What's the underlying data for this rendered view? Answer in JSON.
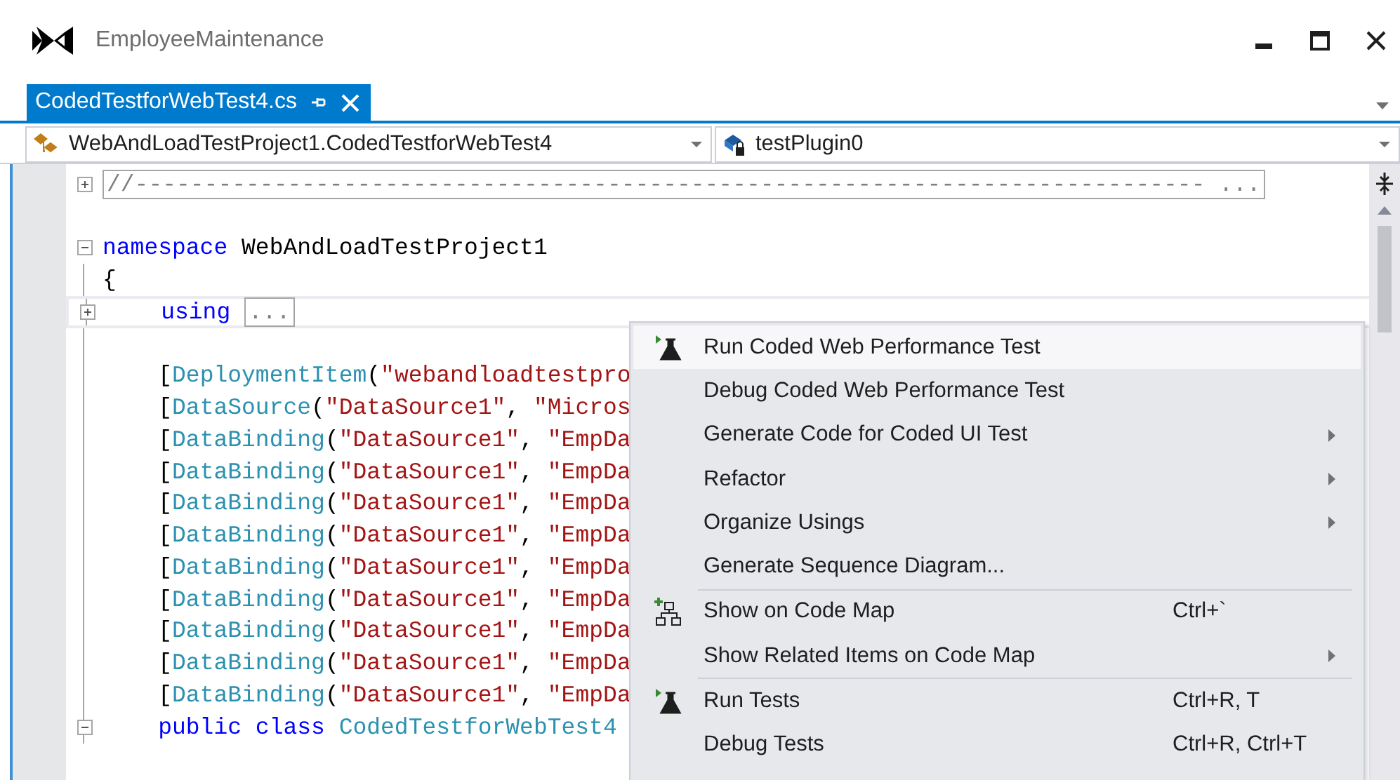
{
  "window": {
    "title": "EmployeeMaintenance"
  },
  "tabs": [
    {
      "label": "CodedTestforWebTest4.cs",
      "selected": true
    }
  ],
  "navigation": {
    "type_dropdown": "WebAndLoadTestProject1.CodedTestforWebTest4",
    "member_dropdown": "testPlugin0"
  },
  "code_lines": [
    {
      "kind": "collapsed-region",
      "current": false,
      "segments": [
        {
          "text": "//----------------------------------------------------------------------------- ...",
          "kind": "collapsed"
        }
      ]
    },
    {
      "kind": "blank",
      "current": false
    },
    {
      "kind": "region-start",
      "current": false,
      "segments": [
        {
          "text": "namespace",
          "kind": "keyword"
        },
        {
          "text": " WebAndLoadTestProject1",
          "kind": "plain"
        }
      ]
    },
    {
      "kind": "code",
      "current": false,
      "segments": [
        {
          "text": "{",
          "kind": "plain"
        }
      ]
    },
    {
      "kind": "collapsed-region",
      "current": true,
      "segments": [
        {
          "text": "    using ",
          "kind": "keyword"
        },
        {
          "text": "...",
          "kind": "collapsed"
        }
      ]
    },
    {
      "kind": "blank",
      "current": false
    },
    {
      "kind": "code",
      "current": false,
      "segments": [
        {
          "text": "    [",
          "kind": "plain"
        },
        {
          "text": "DeploymentItem",
          "kind": "type"
        },
        {
          "text": "(",
          "kind": "plain"
        },
        {
          "text": "\"webandloadtestpro",
          "kind": "string"
        }
      ]
    },
    {
      "kind": "code",
      "current": false,
      "segments": [
        {
          "text": "    [",
          "kind": "plain"
        },
        {
          "text": "DataSource",
          "kind": "type"
        },
        {
          "text": "(",
          "kind": "plain"
        },
        {
          "text": "\"DataSource1\"",
          "kind": "string"
        },
        {
          "text": ", ",
          "kind": "plain"
        },
        {
          "text": "\"Micros",
          "kind": "string"
        }
      ]
    },
    {
      "kind": "code",
      "current": false,
      "segments": [
        {
          "text": "    [",
          "kind": "plain"
        },
        {
          "text": "DataBinding",
          "kind": "type"
        },
        {
          "text": "(",
          "kind": "plain"
        },
        {
          "text": "\"DataSource1\"",
          "kind": "string"
        },
        {
          "text": ", ",
          "kind": "plain"
        },
        {
          "text": "\"EmpDa",
          "kind": "string"
        }
      ]
    },
    {
      "kind": "code",
      "current": false,
      "segments": [
        {
          "text": "    [",
          "kind": "plain"
        },
        {
          "text": "DataBinding",
          "kind": "type"
        },
        {
          "text": "(",
          "kind": "plain"
        },
        {
          "text": "\"DataSource1\"",
          "kind": "string"
        },
        {
          "text": ", ",
          "kind": "plain"
        },
        {
          "text": "\"EmpDa",
          "kind": "string"
        }
      ]
    },
    {
      "kind": "code",
      "current": false,
      "segments": [
        {
          "text": "    [",
          "kind": "plain"
        },
        {
          "text": "DataBinding",
          "kind": "type"
        },
        {
          "text": "(",
          "kind": "plain"
        },
        {
          "text": "\"DataSource1\"",
          "kind": "string"
        },
        {
          "text": ", ",
          "kind": "plain"
        },
        {
          "text": "\"EmpDa",
          "kind": "string"
        }
      ]
    },
    {
      "kind": "code",
      "current": false,
      "segments": [
        {
          "text": "    [",
          "kind": "plain"
        },
        {
          "text": "DataBinding",
          "kind": "type"
        },
        {
          "text": "(",
          "kind": "plain"
        },
        {
          "text": "\"DataSource1\"",
          "kind": "string"
        },
        {
          "text": ", ",
          "kind": "plain"
        },
        {
          "text": "\"EmpDa",
          "kind": "string"
        }
      ]
    },
    {
      "kind": "code",
      "current": false,
      "segments": [
        {
          "text": "    [",
          "kind": "plain"
        },
        {
          "text": "DataBinding",
          "kind": "type"
        },
        {
          "text": "(",
          "kind": "plain"
        },
        {
          "text": "\"DataSource1\"",
          "kind": "string"
        },
        {
          "text": ", ",
          "kind": "plain"
        },
        {
          "text": "\"EmpDa",
          "kind": "string"
        }
      ]
    },
    {
      "kind": "code",
      "current": false,
      "segments": [
        {
          "text": "    [",
          "kind": "plain"
        },
        {
          "text": "DataBinding",
          "kind": "type"
        },
        {
          "text": "(",
          "kind": "plain"
        },
        {
          "text": "\"DataSource1\"",
          "kind": "string"
        },
        {
          "text": ", ",
          "kind": "plain"
        },
        {
          "text": "\"EmpDa",
          "kind": "string"
        }
      ]
    },
    {
      "kind": "code",
      "current": false,
      "segments": [
        {
          "text": "    [",
          "kind": "plain"
        },
        {
          "text": "DataBinding",
          "kind": "type"
        },
        {
          "text": "(",
          "kind": "plain"
        },
        {
          "text": "\"DataSource1\"",
          "kind": "string"
        },
        {
          "text": ", ",
          "kind": "plain"
        },
        {
          "text": "\"EmpDa",
          "kind": "string"
        }
      ]
    },
    {
      "kind": "code",
      "current": false,
      "segments": [
        {
          "text": "    [",
          "kind": "plain"
        },
        {
          "text": "DataBinding",
          "kind": "type"
        },
        {
          "text": "(",
          "kind": "plain"
        },
        {
          "text": "\"DataSource1\"",
          "kind": "string"
        },
        {
          "text": ", ",
          "kind": "plain"
        },
        {
          "text": "\"EmpDa",
          "kind": "string"
        }
      ]
    },
    {
      "kind": "code",
      "current": false,
      "segments": [
        {
          "text": "    [",
          "kind": "plain"
        },
        {
          "text": "DataBinding",
          "kind": "type"
        },
        {
          "text": "(",
          "kind": "plain"
        },
        {
          "text": "\"DataSource1\"",
          "kind": "string"
        },
        {
          "text": ", ",
          "kind": "plain"
        },
        {
          "text": "\"EmpDa",
          "kind": "string"
        }
      ]
    },
    {
      "kind": "region-start",
      "current": false,
      "segments": [
        {
          "text": "    public class ",
          "kind": "keyword"
        },
        {
          "text": "CodedTestforWebTest4",
          "kind": "type"
        }
      ]
    }
  ],
  "context_menu": [
    {
      "kind": "test-item",
      "label": "Run Coded Web Performance Test",
      "submenu": false,
      "selected": true
    },
    {
      "kind": "item",
      "label": "Debug Coded Web Performance Test",
      "submenu": false,
      "selected": false
    },
    {
      "kind": "item",
      "label": "Generate Code for Coded UI Test",
      "submenu": true,
      "selected": false
    },
    {
      "kind": "item",
      "label": "Refactor",
      "submenu": true,
      "selected": false
    },
    {
      "kind": "item",
      "label": "Organize Usings",
      "submenu": true,
      "selected": false
    },
    {
      "kind": "item",
      "label": "Generate Sequence Diagram...",
      "submenu": false,
      "selected": false
    },
    {
      "kind": "separator"
    },
    {
      "kind": "map-item",
      "label": "Show on Code Map",
      "shortcut": "Ctrl+`",
      "submenu": false,
      "selected": false
    },
    {
      "kind": "item",
      "label": "Show Related Items on Code Map",
      "submenu": true,
      "selected": false
    },
    {
      "kind": "separator"
    },
    {
      "kind": "test-item",
      "label": "Run Tests",
      "shortcut": "Ctrl+R, T",
      "submenu": false,
      "selected": false
    },
    {
      "kind": "item",
      "label": "Debug Tests",
      "shortcut": "Ctrl+R, Ctrl+T",
      "submenu": false,
      "selected": false
    }
  ]
}
